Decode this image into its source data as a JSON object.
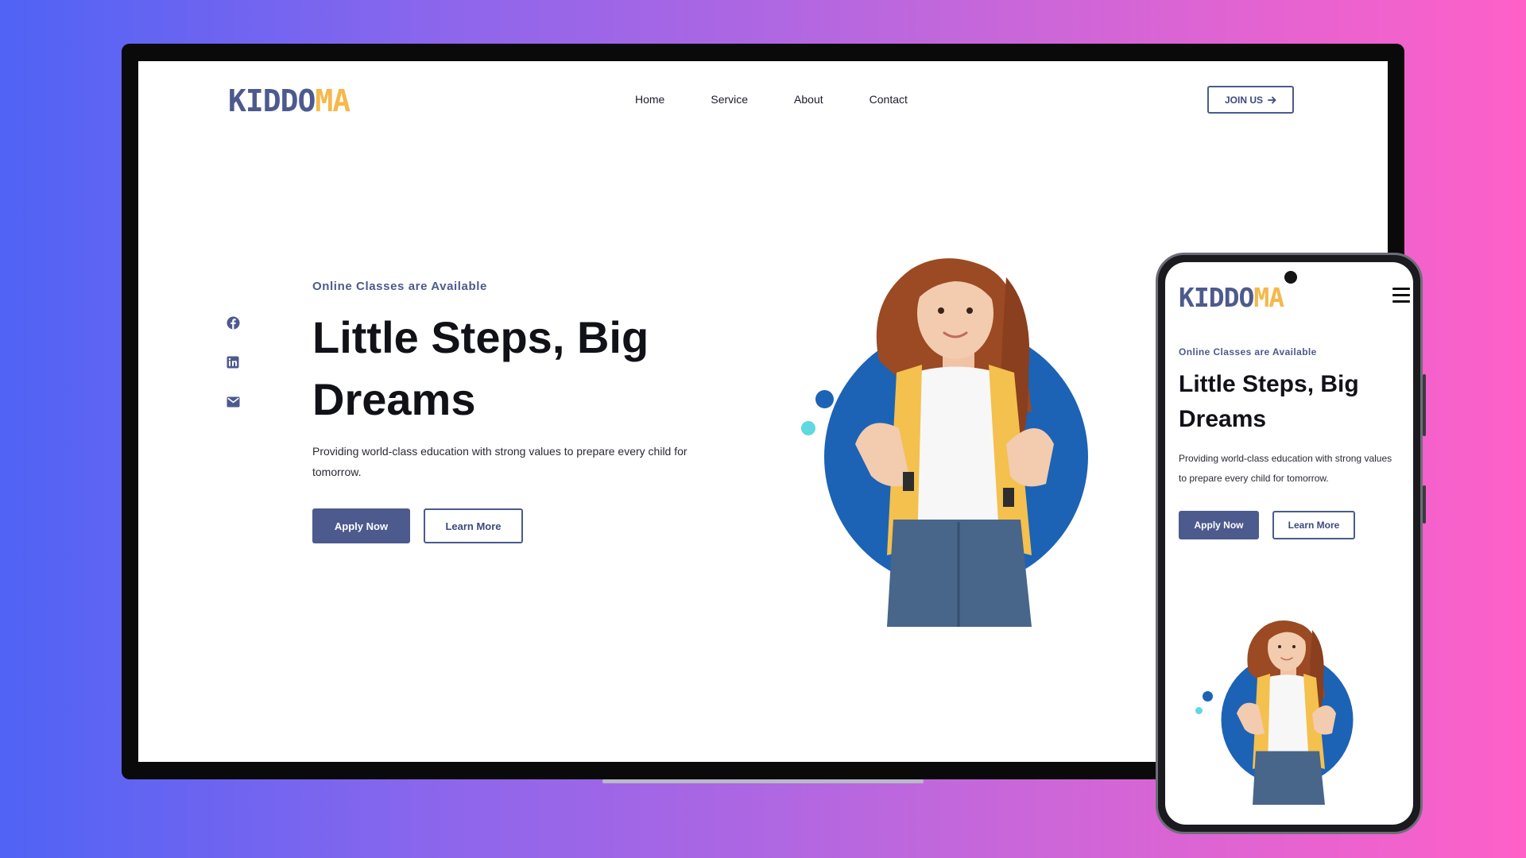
{
  "brand": {
    "part1": "KIDDO",
    "part2": "MA"
  },
  "nav": [
    "Home",
    "Service",
    "About",
    "Contact"
  ],
  "join_label": "JOIN US",
  "hero": {
    "eyebrow": "Online Classes are Available",
    "title": "Little Steps, Big Dreams",
    "description": "Providing world-class education with strong values to prepare every child for tomorrow.",
    "apply_label": "Apply Now",
    "learn_label": "Learn More"
  },
  "icons": [
    "facebook-icon",
    "linkedin-icon",
    "mail-icon",
    "arrow-right-icon",
    "hamburger-menu-icon"
  ],
  "colors": {
    "primary": "#4d5a8e",
    "accent": "#f6b84b",
    "circle_blue": "#1c63b5",
    "dot_cyan": "#5fd8e0"
  }
}
